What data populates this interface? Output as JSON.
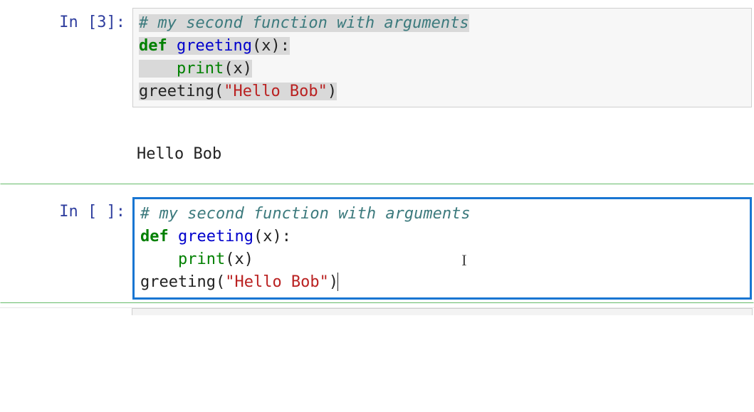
{
  "cell1": {
    "prompt_in": "In ",
    "prompt_open": "[",
    "prompt_count": "3",
    "prompt_close": "]:",
    "line1_comment": "# my second function with arguments",
    "line2_def": "def",
    "line2_space": " ",
    "line2_func": "greeting",
    "line2_paren_open": "(",
    "line2_arg": "x",
    "line2_paren_close": "):",
    "line3_indent": "    ",
    "line3_print": "print",
    "line3_popen": "(",
    "line3_arg": "x",
    "line3_pclose": ")",
    "line4_call": "greeting",
    "line4_popen": "(",
    "line4_str": "\"Hello Bob\"",
    "line4_pclose": ")",
    "output_text": "Hello Bob"
  },
  "cell2": {
    "prompt_in": "In ",
    "prompt_open": "[",
    "prompt_count": " ",
    "prompt_close": "]:",
    "line1_comment": "# my second function with arguments",
    "line2_def": "def",
    "line2_func": "greeting",
    "line2_paren_open": "(",
    "line2_arg": "x",
    "line2_paren_close": "):",
    "line3_indent": "    ",
    "line3_print": "print",
    "line3_popen": "(",
    "line3_arg": "x",
    "line3_pclose": ")",
    "line4_call": "greeting",
    "line4_popen": "(",
    "line4_str": "\"Hello Bob\"",
    "line4_pclose": ")"
  }
}
